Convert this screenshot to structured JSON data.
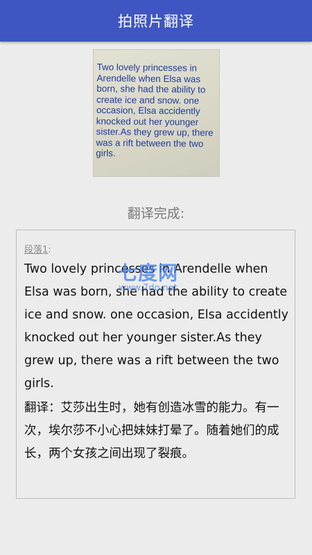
{
  "app_bar": {
    "title": "拍照片翻译"
  },
  "photo": {
    "text": "Two lovely princesses in Arendelle when Elsa was born, she had the ability to create ice and snow. one occasion, Elsa accidently knocked out her younger sister.As they grew up, there was a rift between the two girls."
  },
  "status": "翻译完成:",
  "result": {
    "paragraph_label": "段落1",
    "paragraph_colon": ":",
    "original": "Two lovely princesses in Arendelle when Elsa was born, she had the ability to create ice and snow. one occasion, Elsa accidently knocked out her younger sister.As they grew up, there was a rift between the two girls.",
    "translation": "翻译：艾莎出生时，她有创造冰雪的能力。有一次，埃尔莎不小心把妹妹打晕了。随着她们的成长，两个女孩之间出现了裂痕。"
  },
  "watermark": {
    "main": "七度网",
    "sub": "www.7do.net"
  },
  "colors": {
    "app_bar": "#3f56c2",
    "background": "#ececec",
    "photo_text": "#1d3b9a",
    "watermark": "#4682eb"
  }
}
